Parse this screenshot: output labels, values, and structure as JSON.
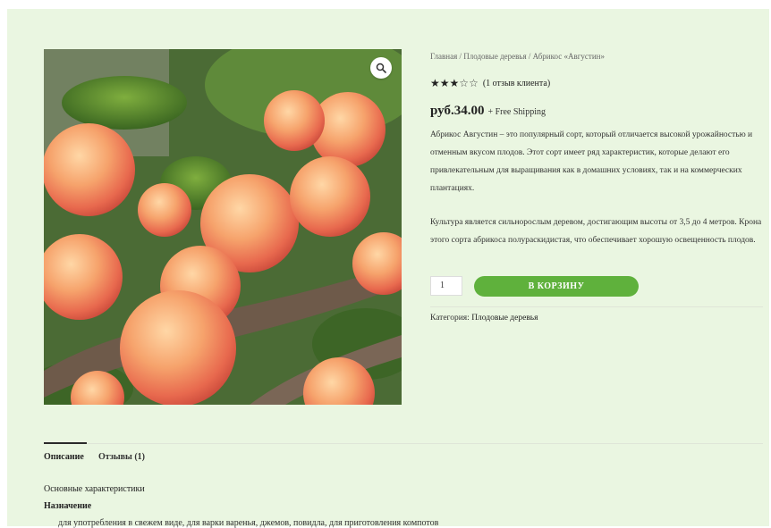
{
  "breadcrumb": {
    "home": "Главная",
    "category": "Плодовые деревья",
    "current": "Абрикос «Августин»",
    "separator": " / "
  },
  "rating": {
    "filled_stars": 3,
    "total_stars": 5,
    "review_link": "(1 отзыв клиента)"
  },
  "price": {
    "amount": "руб.34.00",
    "shipping": "+ Free Shipping"
  },
  "description": {
    "paragraph1": "Абрикос Августин – это популярный сорт, который отличается высокой урожайностью и отменным вкусом плодов. Этот сорт имеет ряд характеристик, которые делают его привлекательным для выращивания как в домашних условиях, так и на коммерческих плантациях.",
    "paragraph2": "Культура является сильнорослым деревом, достигающим высоты от 3,5 до 4 метров. Крона этого сорта абрикоса полураскидистая, что обеспечивает хорошую освещенность плодов."
  },
  "cart": {
    "quantity": "1",
    "button_label": "В КОРЗИНУ"
  },
  "meta": {
    "category_label": "Категория:",
    "category_value": "Плодовые деревья"
  },
  "tabs": [
    {
      "label": "Описание"
    },
    {
      "label": "Отзывы (1)"
    }
  ],
  "tab_content": {
    "characteristics": "Основные характеристики",
    "purpose_heading": "Назначение",
    "usage": "для употребления в свежем виде, для варки варенья, джемов, повидла, для приготовления компотов"
  },
  "colors": {
    "background": "#eaf6e1",
    "accent_green": "#5fb13c"
  },
  "icons": {
    "zoom": "magnifier-icon",
    "star": "star-icon"
  }
}
